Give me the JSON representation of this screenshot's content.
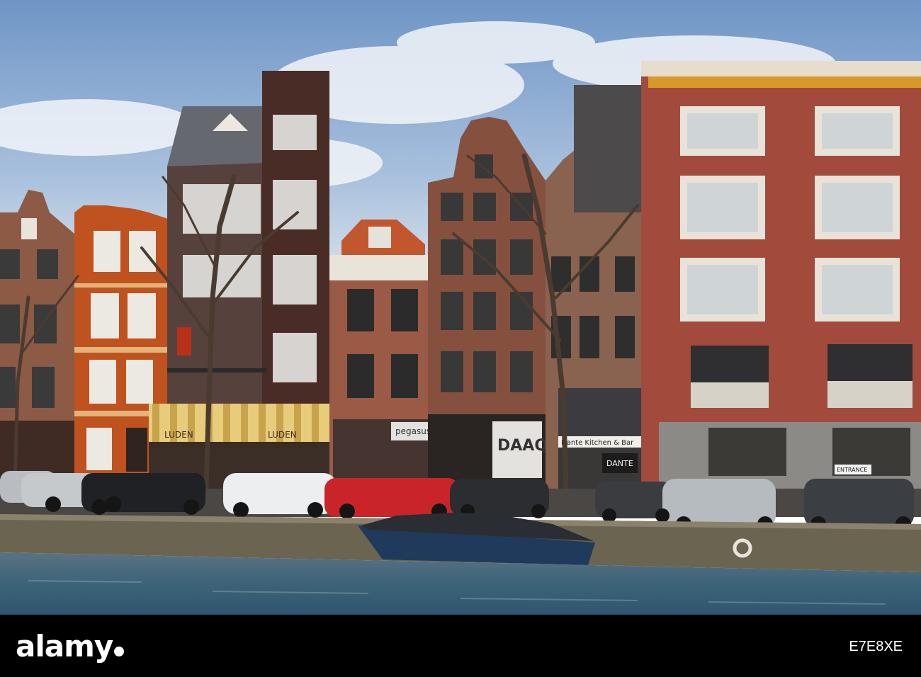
{
  "scene": {
    "signs": {
      "luden_left": "LUDEN",
      "luden_right": "LUDEN",
      "pegasus": "pegasus",
      "daaq": "DAAQ",
      "dante_awning": "Dante Kitchen & Bar",
      "dante_window": "DANTE",
      "entrance": "ENTRANCE"
    }
  },
  "footer": {
    "logo": "alamy",
    "image_id": "E7E8XE"
  }
}
